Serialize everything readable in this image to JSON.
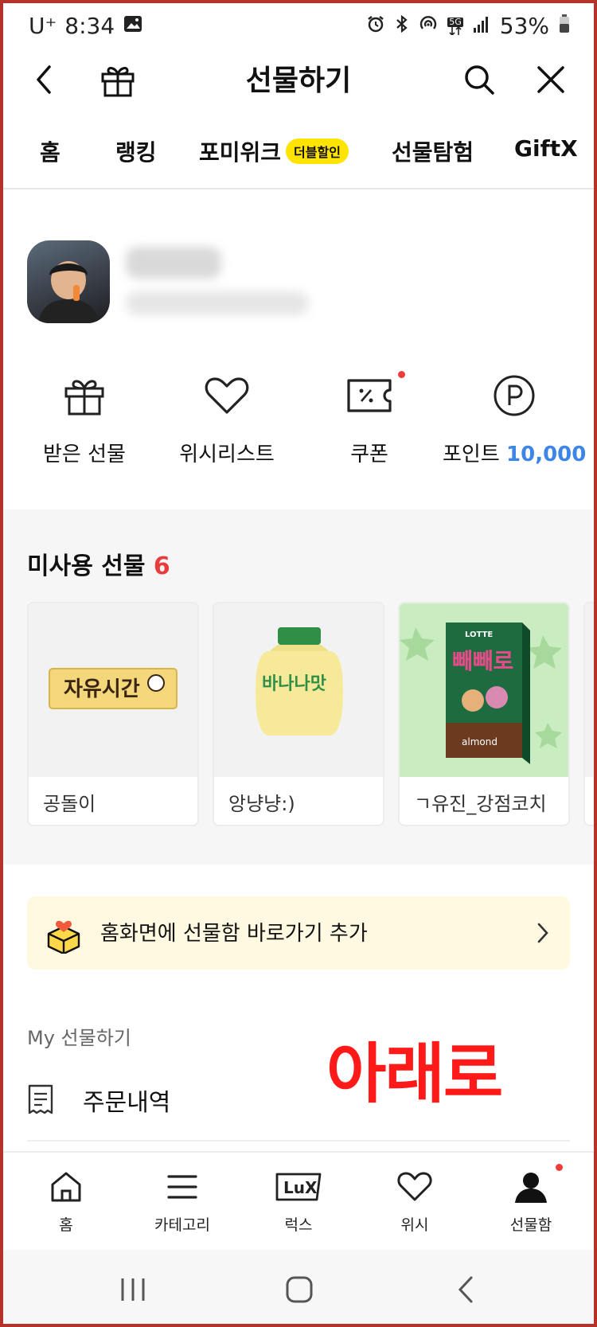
{
  "status": {
    "carrier": "U⁺",
    "time": "8:34",
    "battery": "53%",
    "network": "5G"
  },
  "header": {
    "title": "선물하기"
  },
  "tabs": [
    {
      "label": "홈"
    },
    {
      "label": "랭킹"
    },
    {
      "label": "포미위크",
      "badge": "더블할인"
    },
    {
      "label": "선물탐험"
    },
    {
      "label": "GiftX"
    }
  ],
  "quick_menu": {
    "received": "받은 선물",
    "wishlist": "위시리스트",
    "coupon": "쿠폰",
    "point_label": "포인트",
    "point_value": "10,000"
  },
  "unused": {
    "title": "미사용 선물",
    "count": "6",
    "items": [
      {
        "name": "공돌이",
        "product_text": "자유시간"
      },
      {
        "name": "앙냥냥:)",
        "product_text": "바나나맛"
      },
      {
        "name": "ㄱ유진_강점코치",
        "product_text": "빼빼로",
        "product_sub": "almond",
        "brand": "LOTTE"
      }
    ]
  },
  "banner": {
    "text": "홈화면에 선물함 바로가기 추가"
  },
  "my": {
    "title": "My 선물하기",
    "order": "주문내역"
  },
  "overlay": {
    "text": "아래로"
  },
  "bottom_nav": {
    "home": "홈",
    "category": "카테고리",
    "lux": "럭스",
    "wish": "위시",
    "giftbox": "선물함",
    "lux_logo": "LuX"
  },
  "colors": {
    "accent_blue": "#3d86e8",
    "badge_yellow": "#ffe400",
    "count_red": "#e93d3d",
    "overlay_red": "#ff1a1a"
  }
}
